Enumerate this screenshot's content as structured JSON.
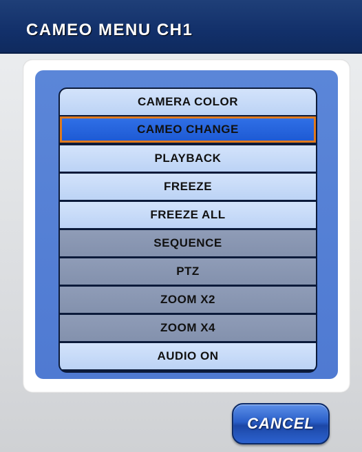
{
  "window": {
    "title": "CAMEO MENU CH1"
  },
  "menu": {
    "items": [
      {
        "label": "CAMERA COLOR",
        "state": "enabled"
      },
      {
        "label": "CAMEO CHANGE",
        "state": "selected"
      },
      {
        "label": "PLAYBACK",
        "state": "enabled"
      },
      {
        "label": "FREEZE",
        "state": "enabled"
      },
      {
        "label": "FREEZE ALL",
        "state": "enabled"
      },
      {
        "label": "SEQUENCE",
        "state": "disabled"
      },
      {
        "label": "PTZ",
        "state": "disabled"
      },
      {
        "label": "ZOOM X2",
        "state": "disabled"
      },
      {
        "label": "ZOOM X4",
        "state": "disabled"
      },
      {
        "label": "AUDIO ON",
        "state": "enabled"
      }
    ]
  },
  "footer": {
    "cancel_label": "CANCEL"
  },
  "colors": {
    "title_bar": "#12306a",
    "selection_border": "#e07a1e",
    "selection_fill": "#2f6fe6",
    "item_enabled": "#c8dbf8",
    "item_disabled": "#8a97b2"
  }
}
